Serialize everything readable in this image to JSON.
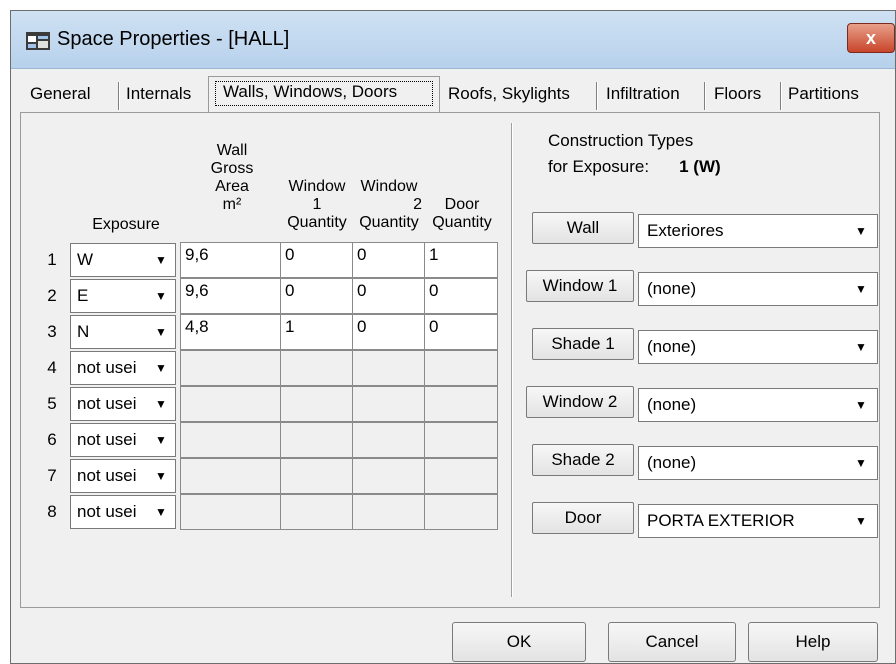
{
  "window": {
    "title": "Space Properties - [HALL]",
    "close_label": "x"
  },
  "tabs": [
    {
      "label": "General"
    },
    {
      "label": "Internals"
    },
    {
      "label": "Walls, Windows, Doors"
    },
    {
      "label": "Roofs, Skylights"
    },
    {
      "label": "Infiltration"
    },
    {
      "label": "Floors"
    },
    {
      "label": "Partitions"
    }
  ],
  "active_tab": "Walls, Windows, Doors",
  "headers": {
    "exposure": "Exposure",
    "wall_area_1": "Wall",
    "wall_area_2": "Gross",
    "wall_area_3": "Area",
    "wall_area_4": "m²",
    "window1_1": "Window",
    "window1_2": "1",
    "window1_3": "Quantity",
    "window2_1": "Window",
    "window2_2": "2",
    "window2_3": "Quantity",
    "door_1": "Door",
    "door_2": "Quantity"
  },
  "rows": [
    {
      "num": "1",
      "exposure": "W",
      "area": "9,6",
      "win1": "0",
      "win2": "0",
      "door": "1"
    },
    {
      "num": "2",
      "exposure": "E",
      "area": "9,6",
      "win1": "0",
      "win2": "0",
      "door": "0"
    },
    {
      "num": "3",
      "exposure": "N",
      "area": "4,8",
      "win1": "1",
      "win2": "0",
      "door": "0"
    },
    {
      "num": "4",
      "exposure": "not usei",
      "area": "",
      "win1": "",
      "win2": "",
      "door": ""
    },
    {
      "num": "5",
      "exposure": "not usei",
      "area": "",
      "win1": "",
      "win2": "",
      "door": ""
    },
    {
      "num": "6",
      "exposure": "not usei",
      "area": "",
      "win1": "",
      "win2": "",
      "door": ""
    },
    {
      "num": "7",
      "exposure": "not usei",
      "area": "",
      "win1": "",
      "win2": "",
      "door": ""
    },
    {
      "num": "8",
      "exposure": "not usei",
      "area": "",
      "win1": "",
      "win2": "",
      "door": ""
    }
  ],
  "construction": {
    "title_line1": "Construction Types",
    "title_line2": "for Exposure:",
    "exposure_value": "1 (W)",
    "items": [
      {
        "button": "Wall",
        "value": "Exteriores"
      },
      {
        "button": "Window 1",
        "value": "(none)"
      },
      {
        "button": "Shade 1",
        "value": "(none)"
      },
      {
        "button": "Window 2",
        "value": "(none)"
      },
      {
        "button": "Shade 2",
        "value": "(none)"
      },
      {
        "button": "Door",
        "value": "PORTA EXTERIOR"
      }
    ]
  },
  "footer": {
    "ok": "OK",
    "cancel": "Cancel",
    "help": "Help"
  },
  "icons": {
    "dropdown": "dropdown-arrow-icon",
    "app": "app-window-icon",
    "close": "close-icon"
  },
  "colors": {
    "title_bar": "#c4daf0",
    "close_button": "#c8452b",
    "face": "#f0f0f0"
  }
}
